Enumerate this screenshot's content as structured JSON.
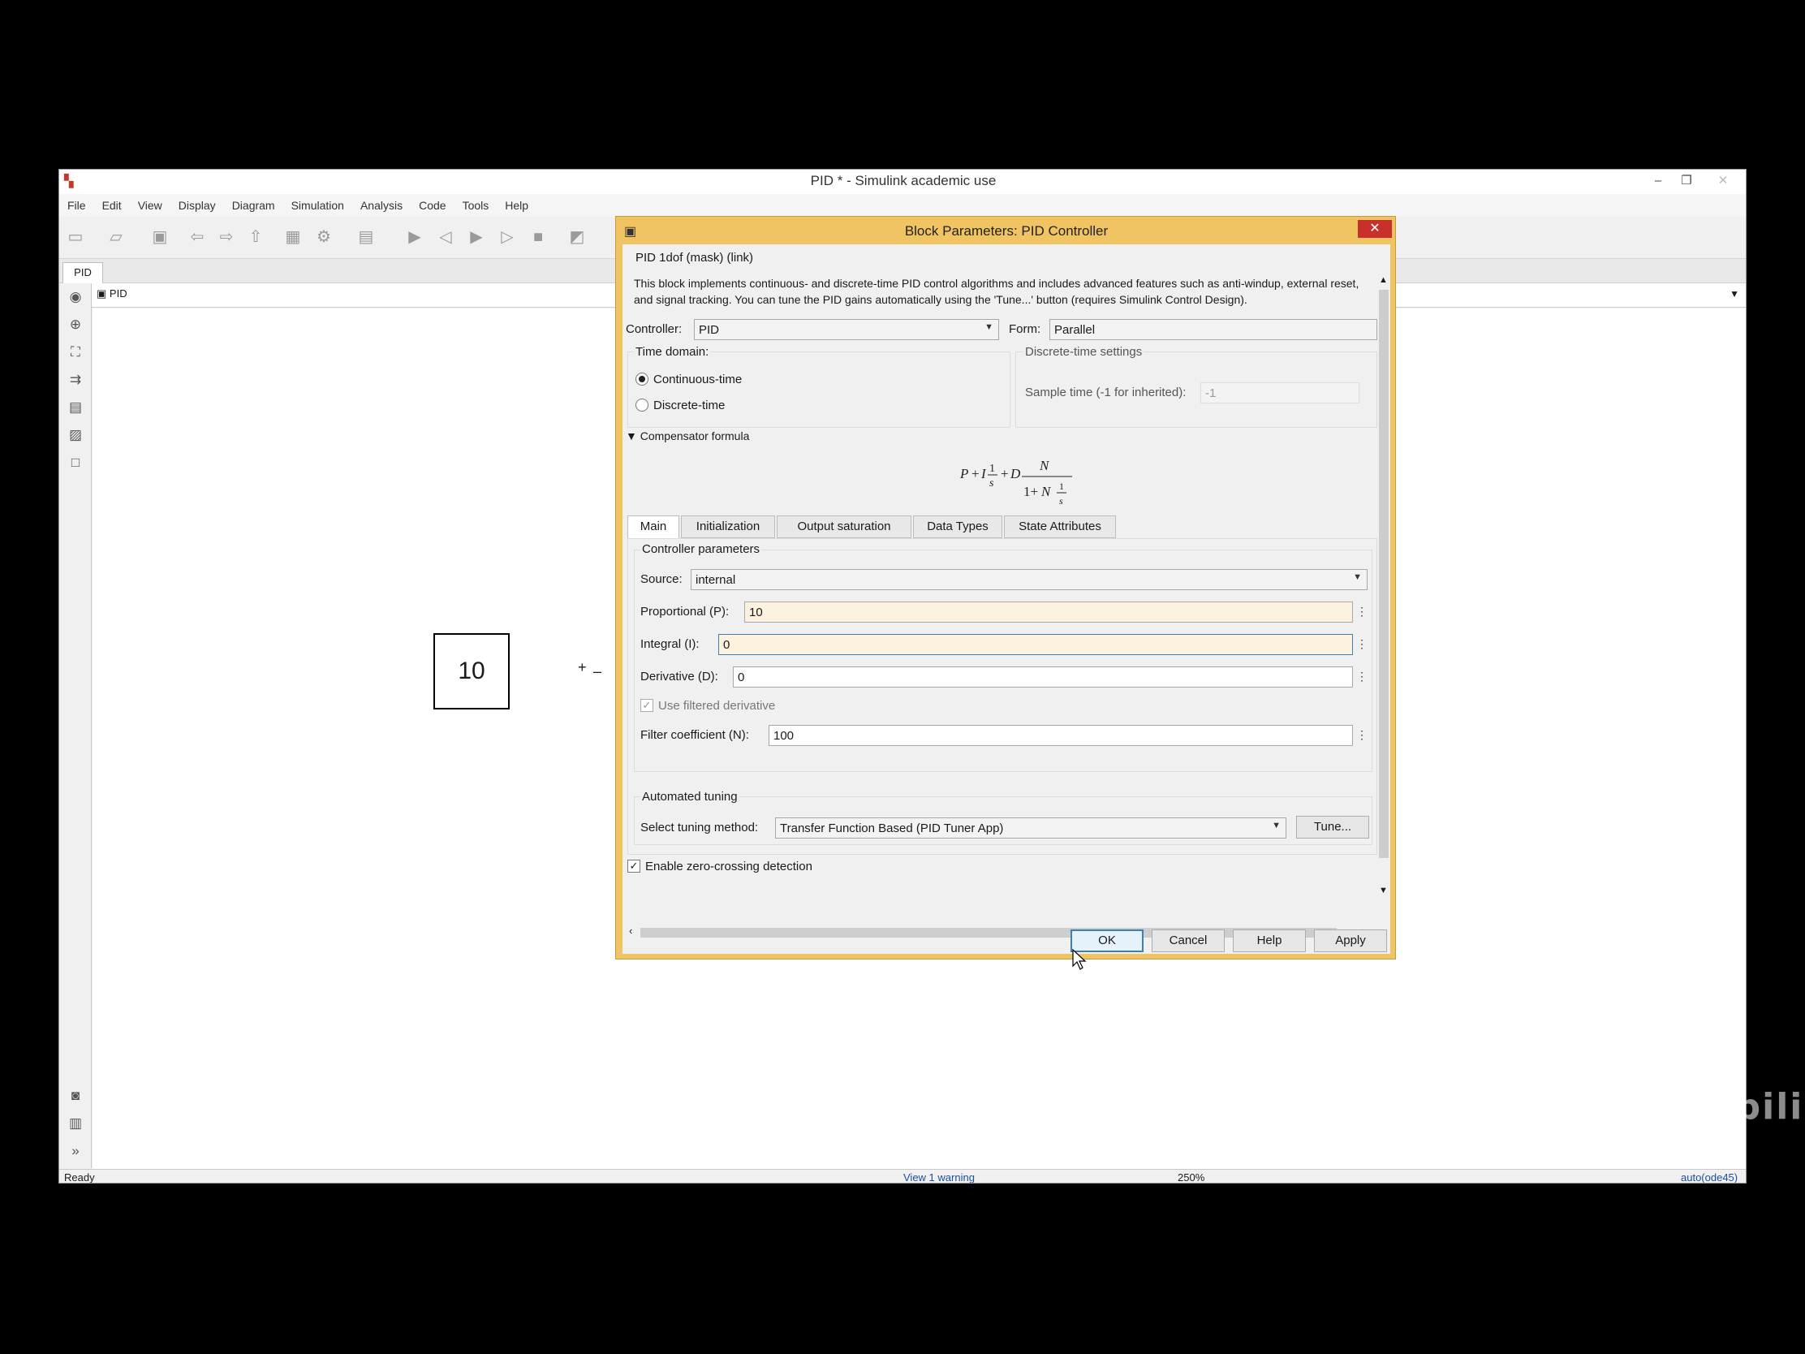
{
  "window": {
    "title": "PID * - Simulink academic use",
    "controls": {
      "minimize": "–",
      "restore": "❐",
      "close": "✕"
    }
  },
  "menu": [
    "File",
    "Edit",
    "View",
    "Display",
    "Diagram",
    "Simulation",
    "Analysis",
    "Code",
    "Tools",
    "Help"
  ],
  "model_tab": "PID",
  "breadcrumb": "PID",
  "diagram": {
    "constant_value": "10",
    "sum_plus": "+",
    "sum_minus": "–"
  },
  "status": {
    "left": "Ready",
    "warning": "View 1 warning",
    "zoom": "250%",
    "solver": "auto(ode45)"
  },
  "dialog": {
    "title": "Block Parameters: PID Controller",
    "close": "✕",
    "header": "PID 1dof (mask) (link)",
    "description": "This block implements continuous- and discrete-time PID control algorithms and includes advanced features such as anti-windup, external reset, and signal tracking. You can tune the PID gains automatically using the 'Tune...' button (requires Simulink Control Design).",
    "controller_label": "Controller:",
    "controller_value": "PID",
    "form_label": "Form:",
    "form_value": "Parallel",
    "time_domain_label": "Time domain:",
    "continuous_label": "Continuous-time",
    "discrete_label": "Discrete-time",
    "continuous_selected": true,
    "discrete_settings_label": "Discrete-time settings",
    "sample_time_label": "Sample time (-1 for inherited):",
    "sample_time_value": "-1",
    "compensator_label": "Compensator formula",
    "tabs": [
      "Main",
      "Initialization",
      "Output saturation",
      "Data Types",
      "State Attributes"
    ],
    "active_tab": "Main",
    "controller_params_label": "Controller parameters",
    "source_label": "Source:",
    "source_value": "internal",
    "p_label": "Proportional (P):",
    "p_value": "10",
    "i_label": "Integral (I):",
    "i_value": "0",
    "d_label": "Derivative (D):",
    "d_value": "0",
    "filtered_label": "Use filtered derivative",
    "filtered_checked": true,
    "n_label": "Filter coefficient (N):",
    "n_value": "100",
    "auto_tuning_label": "Automated tuning",
    "tuning_method_label": "Select tuning method:",
    "tuning_method_value": "Transfer Function Based (PID Tuner App)",
    "tune_button": "Tune...",
    "zero_crossing_label": "Enable zero-crossing detection",
    "zero_crossing_checked": true,
    "buttons": {
      "ok": "OK",
      "cancel": "Cancel",
      "help": "Help",
      "apply": "Apply"
    }
  },
  "watermark": "DR_CAN bilibili"
}
